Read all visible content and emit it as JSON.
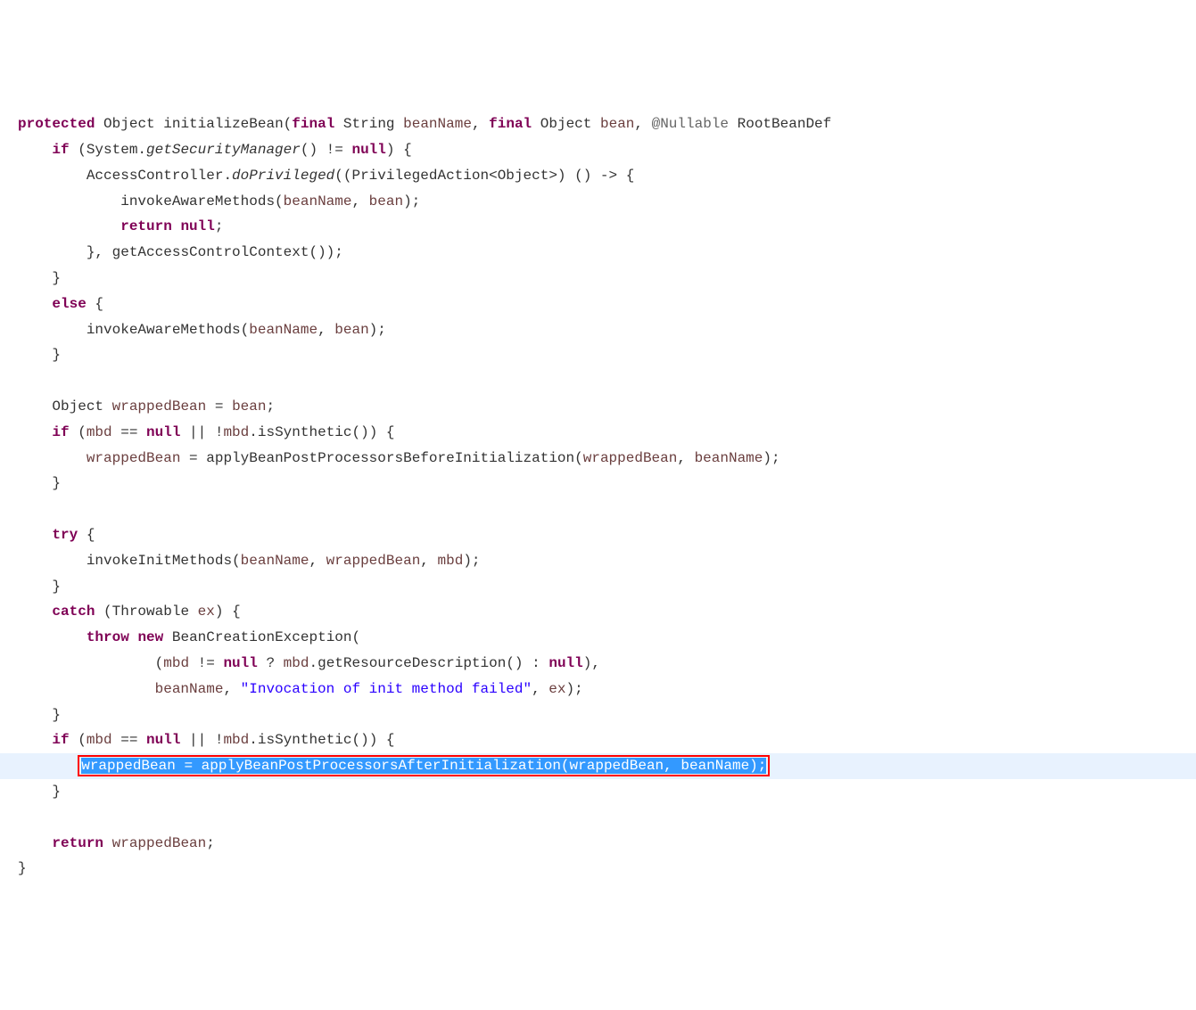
{
  "tokens": {
    "protected": "protected",
    "final": "final",
    "if": "if",
    "else": "else",
    "return": "return",
    "null": "null",
    "try": "try",
    "catch": "catch",
    "throw": "throw",
    "new": "new",
    "Object": "Object",
    "String": "String",
    "RootBeanDef": "RootBeanDef",
    "Nullable": "@Nullable",
    "Throwable": "Throwable",
    "method_name": "initializeBean",
    "System": "System",
    "getSecurityManager": "getSecurityManager",
    "AccessController": "AccessController",
    "doPrivileged": "doPrivileged",
    "PrivilegedAction": "PrivilegedAction",
    "invokeAwareMethods": "invokeAwareMethods",
    "getAccessControlContext": "getAccessControlContext",
    "wrappedBean": "wrappedBean",
    "bean": "bean",
    "beanName": "beanName",
    "mbd": "mbd",
    "isSynthetic": "isSynthetic",
    "applyBeanPostProcessorsBeforeInitialization": "applyBeanPostProcessorsBeforeInitialization",
    "invokeInitMethods": "invokeInitMethods",
    "ex": "ex",
    "BeanCreationException": "BeanCreationException",
    "getResourceDescription": "getResourceDescription",
    "applyBeanPostProcessorsAfterInitialization": "applyBeanPostProcessorsAfterInitialization",
    "str_init_failed": "\"Invocation of init method failed\""
  }
}
